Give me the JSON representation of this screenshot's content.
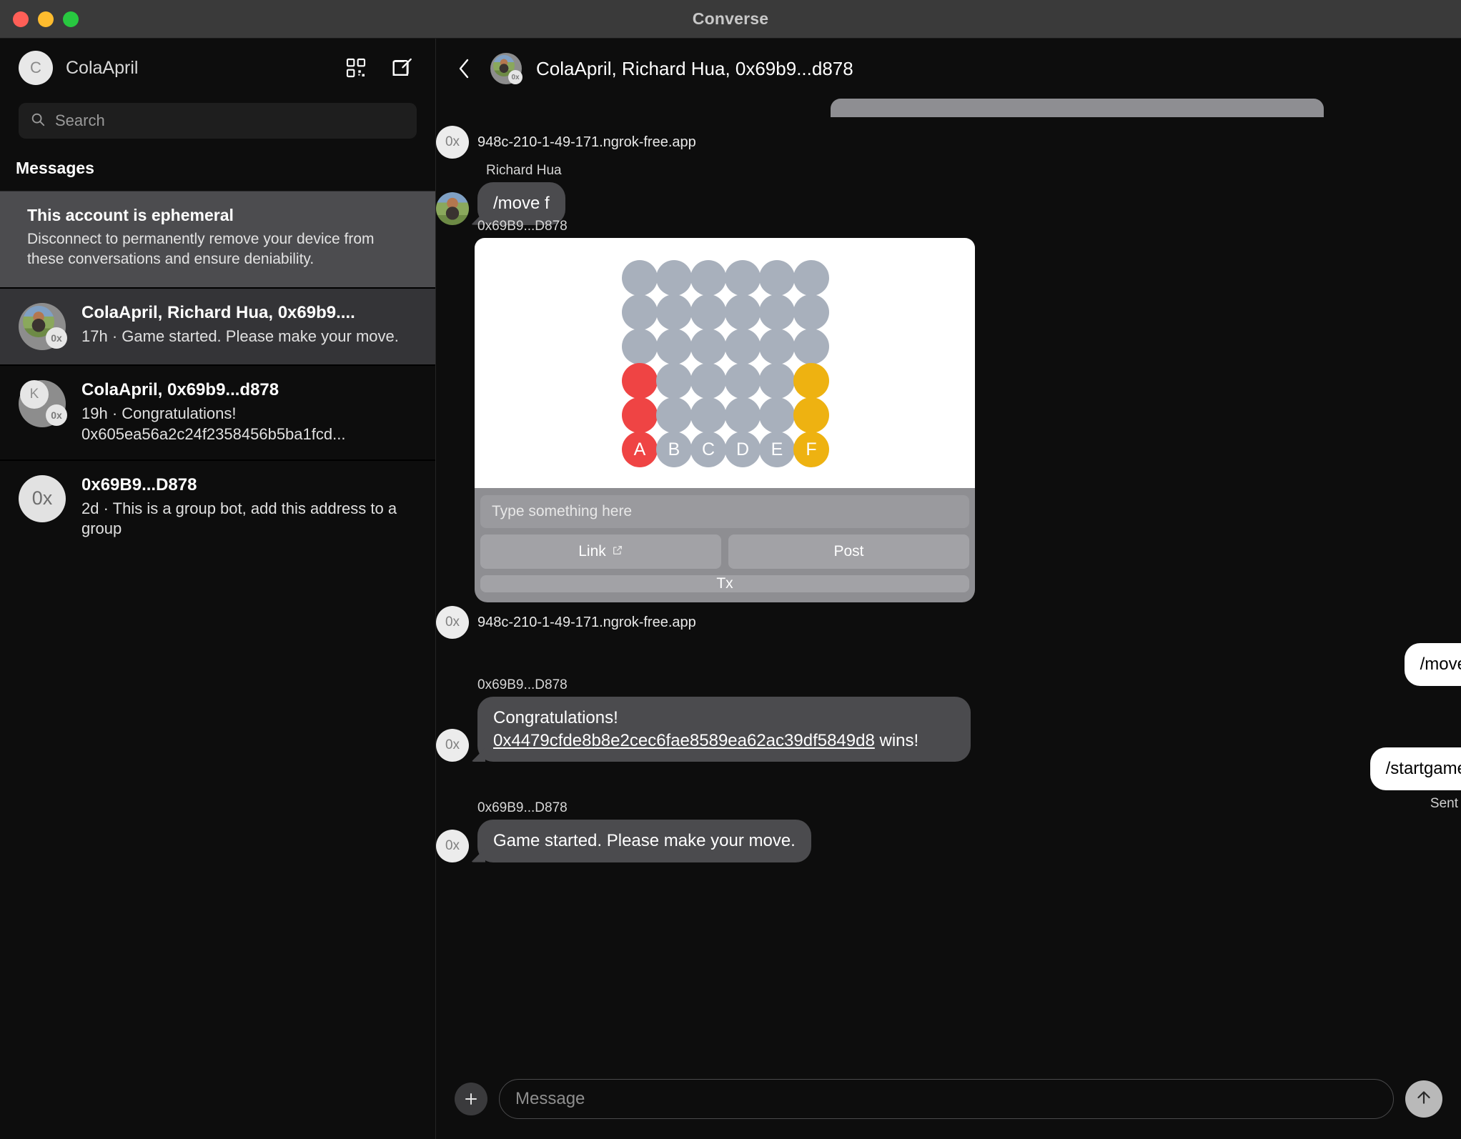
{
  "window": {
    "title": "Converse",
    "traffic_lights": [
      "close-red",
      "minimize-yellow",
      "maximize-green"
    ]
  },
  "sidebar": {
    "account": {
      "initial": "C",
      "name": "ColaApril"
    },
    "actions": [
      {
        "name": "qr-code-icon",
        "label": "QR Code"
      },
      {
        "name": "compose-icon",
        "label": "New Conversation"
      }
    ],
    "search": {
      "placeholder": "Search",
      "value": "",
      "icon": "search-icon"
    },
    "section_title": "Messages",
    "ephemeral_banner": {
      "title": "This account is ephemeral",
      "body": "Disconnect to permanently remove your device from these conversations and ensure deniability."
    },
    "conversations": [
      {
        "title": "ColaApril, Richard Hua, 0x69b9....",
        "time": "17h",
        "preview": "Game started. Please make your move.",
        "avatar_kind": "photo-group",
        "avatar_badge": "0x",
        "active": true
      },
      {
        "title": "ColaApril, 0x69b9...d878",
        "time": "19h",
        "preview": "Congratulations! 0x605ea56a2c24f2358456b5ba1fcd...",
        "avatar_kind": "letter-group",
        "avatar_letter": "K",
        "avatar_badge": "0x",
        "active": false
      },
      {
        "title": "0x69B9...D878",
        "time": "2d",
        "preview": "This is a group bot, add this address to a group",
        "avatar_kind": "letter",
        "avatar_letter": "0x",
        "active": false
      }
    ]
  },
  "chat": {
    "back_icon": "chevron-left-icon",
    "header_title": "ColaApril, Richard Hua, 0x69b9...d878",
    "header_avatar_badge": "0x",
    "messages": [
      {
        "id": "m1",
        "type": "clipped-frame",
        "kind": "incoming"
      },
      {
        "id": "m2",
        "type": "url",
        "kind": "incoming",
        "avatar": "0x",
        "text": "948c-210-1-49-171.ngrok-free.app"
      },
      {
        "id": "m3",
        "type": "text",
        "kind": "incoming",
        "sender": "Richard Hua",
        "avatar": "photo",
        "text": "/move f"
      },
      {
        "id": "m4",
        "type": "frame",
        "kind": "incoming",
        "sender": "0x69B9...D878"
      },
      {
        "id": "m5",
        "type": "url",
        "kind": "incoming",
        "avatar": "0x",
        "text": "948c-210-1-49-171.ngrok-free.app"
      },
      {
        "id": "m6",
        "type": "text",
        "kind": "outgoing",
        "text": "/move a"
      },
      {
        "id": "m7",
        "type": "rich",
        "kind": "incoming",
        "sender": "0x69B9...D878",
        "avatar": "0x",
        "prefix": "Congratulations! ",
        "link": "0x4479cfde8b8e2cec6fae8589ea62ac39df5849d8",
        "suffix": " wins!"
      },
      {
        "id": "m8",
        "type": "text",
        "kind": "outgoing",
        "text": "/startgame",
        "status": "Sent"
      },
      {
        "id": "m9",
        "type": "text",
        "kind": "incoming",
        "sender": "0x69B9...D878",
        "avatar": "0x",
        "text": "Game started. Please make your move."
      }
    ],
    "frame": {
      "input_placeholder": "Type something here",
      "buttons": [
        {
          "label": "Link",
          "icon": "external-link-icon"
        },
        {
          "label": "Post",
          "icon": null
        },
        {
          "label": "Tx",
          "icon": null
        }
      ]
    },
    "composer": {
      "add_icon": "plus-icon",
      "placeholder": "Message",
      "value": "",
      "send_icon": "arrow-up-icon"
    }
  },
  "chart_data": {
    "type": "table",
    "title": "Connect Four board state",
    "columns": [
      "A",
      "B",
      "C",
      "D",
      "E",
      "F"
    ],
    "rows": 6,
    "colors": {
      "empty": "#a8b0bc",
      "red": "#ef4444",
      "yellow": "#eeb211",
      "board_bg": "#ffffff"
    },
    "grid": [
      [
        "empty",
        "empty",
        "empty",
        "empty",
        "empty",
        "empty"
      ],
      [
        "empty",
        "empty",
        "empty",
        "empty",
        "empty",
        "empty"
      ],
      [
        "empty",
        "empty",
        "empty",
        "empty",
        "empty",
        "empty"
      ],
      [
        "red",
        "empty",
        "empty",
        "empty",
        "empty",
        "yellow"
      ],
      [
        "red",
        "empty",
        "empty",
        "empty",
        "empty",
        "yellow"
      ],
      [
        "red",
        "empty",
        "empty",
        "empty",
        "empty",
        "yellow"
      ]
    ],
    "labels_row": [
      "A",
      "B",
      "C",
      "D",
      "E",
      "F"
    ]
  }
}
